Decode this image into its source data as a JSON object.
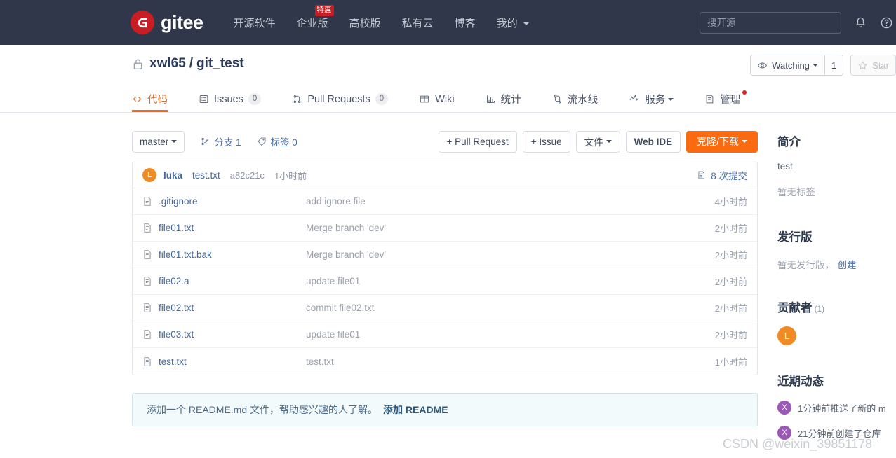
{
  "navbar": {
    "logo_text": "gitee",
    "logo_icon": "gitee-logo-icon",
    "menu": [
      {
        "label": "开源软件",
        "badge": null
      },
      {
        "label": "企业版",
        "badge": "特惠"
      },
      {
        "label": "高校版",
        "badge": null
      },
      {
        "label": "私有云",
        "badge": null
      },
      {
        "label": "博客",
        "badge": null
      },
      {
        "label": "我的",
        "badge": null,
        "has_caret": true
      }
    ],
    "search_placeholder": "搜开源",
    "search_value": "",
    "bell_icon": "bell-icon",
    "help_icon": "help-circle-icon"
  },
  "repo": {
    "lock_icon": "lock-icon",
    "owner": "xwl65",
    "separator": "/",
    "name": "git_test",
    "watch_icon": "eye-icon",
    "watch_label": "Watching",
    "watch_count": "1",
    "star_icon": "star-icon",
    "star_label": "Star"
  },
  "tabs": [
    {
      "label": "代码",
      "icon": "code-icon",
      "active": true,
      "count": null
    },
    {
      "label": "Issues",
      "icon": "issue-icon",
      "active": false,
      "count": "0"
    },
    {
      "label": "Pull Requests",
      "icon": "pull-request-icon",
      "active": false,
      "count": "0"
    },
    {
      "label": "Wiki",
      "icon": "book-icon",
      "active": false,
      "count": null
    },
    {
      "label": "统计",
      "icon": "chart-icon",
      "active": false,
      "count": null
    },
    {
      "label": "流水线",
      "icon": "pipeline-icon",
      "active": false,
      "count": null
    },
    {
      "label": "服务",
      "icon": "activity-icon",
      "active": false,
      "count": null,
      "has_caret": true
    },
    {
      "label": "管理",
      "icon": "settings-list-icon",
      "active": false,
      "count": null,
      "has_dot": true
    }
  ],
  "toolbar": {
    "branch": "master",
    "branches_icon": "branch-icon",
    "branches_label": "分支 1",
    "tags_icon": "tag-icon",
    "tags_label": "标签 0",
    "pull_request_button": "+ Pull Request",
    "issue_button": "+ Issue",
    "files_button": "文件",
    "webide_button": "Web IDE",
    "clone_button": "克隆/下载"
  },
  "commit_bar": {
    "avatar_letter": "L",
    "author": "luka",
    "message": "test.txt",
    "sha": "a82c21c",
    "time": "1小时前",
    "commits_icon": "history-icon",
    "commits_label": "8 次提交"
  },
  "files": [
    {
      "icon": "file-icon",
      "name": ".gitignore",
      "message": "add ignore file",
      "time": "4小时前"
    },
    {
      "icon": "file-icon",
      "name": "file01.txt",
      "message": "Merge branch 'dev'",
      "time": "2小时前"
    },
    {
      "icon": "file-icon",
      "name": "file01.txt.bak",
      "message": "Merge branch 'dev'",
      "time": "2小时前"
    },
    {
      "icon": "file-icon",
      "name": "file02.a",
      "message": "update file01",
      "time": "2小时前"
    },
    {
      "icon": "file-icon",
      "name": "file02.txt",
      "message": "commit file02.txt",
      "time": "2小时前"
    },
    {
      "icon": "file-icon",
      "name": "file03.txt",
      "message": "update file01",
      "time": "2小时前"
    },
    {
      "icon": "file-icon",
      "name": "test.txt",
      "message": "test.txt",
      "time": "1小时前"
    }
  ],
  "readme_notice": {
    "text": "添加一个 README.md 文件，帮助感兴趣的人了解。",
    "link": "添加 README"
  },
  "sidebar": {
    "about_heading": "简介",
    "about_text": "test",
    "no_tags": "暂无标签",
    "releases_heading": "发行版",
    "no_releases": "暂无发行版，",
    "create_release": "创建",
    "contributors_heading": "贡献者",
    "contributors_count": "(1)",
    "contributor_avatar": "L",
    "activity_heading": "近期动态",
    "activities": [
      {
        "avatar": "X",
        "time": "1分钟前",
        "text": "推送了新的 m"
      },
      {
        "avatar": "X",
        "time": "21分钟前",
        "text": "创建了仓库"
      }
    ]
  },
  "watermark": "CSDN @weixin_39851178",
  "colors": {
    "navbar_bg": "#31374a",
    "brand_red": "#c71d23",
    "accent_orange": "#ec6b23",
    "clone_orange": "#f96a11",
    "link_blue": "#41699e",
    "avatar_orange": "#f08a24",
    "activity_purple": "#9b59b6"
  }
}
